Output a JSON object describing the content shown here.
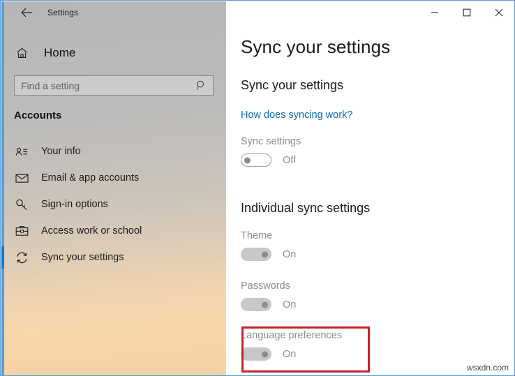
{
  "window": {
    "app_title": "Settings",
    "back_icon": "back-arrow-icon",
    "controls": {
      "minimize": "minimize-icon",
      "maximize": "maximize-icon",
      "close": "close-icon"
    },
    "accent_color": "#5a9bd5"
  },
  "sidebar": {
    "home_label": "Home",
    "home_icon": "home-icon",
    "search": {
      "placeholder": "Find a setting",
      "value": "",
      "icon": "search-icon"
    },
    "section_label": "Accounts",
    "items": [
      {
        "label": "Your info",
        "icon": "person-card-icon",
        "selected": false
      },
      {
        "label": "Email & app accounts",
        "icon": "envelope-icon",
        "selected": false
      },
      {
        "label": "Sign-in options",
        "icon": "key-icon",
        "selected": false
      },
      {
        "label": "Access work or school",
        "icon": "briefcase-icon",
        "selected": false
      },
      {
        "label": "Sync your settings",
        "icon": "sync-refresh-icon",
        "selected": true
      }
    ],
    "selected_accent": "#0a78d4"
  },
  "main": {
    "page_title": "Sync your settings",
    "subheading_1": "Sync your settings",
    "link_text": "How does syncing work?",
    "link_color": "#0a6cbe",
    "sync_settings": {
      "label": "Sync settings",
      "state": "Off",
      "toggle": "off"
    },
    "subheading_2": "Individual sync settings",
    "individual": [
      {
        "label": "Theme",
        "state": "On",
        "toggle": "on-disabled"
      },
      {
        "label": "Passwords",
        "state": "On",
        "toggle": "on-disabled"
      },
      {
        "label": "Language preferences",
        "state": "On",
        "toggle": "on-disabled"
      }
    ]
  },
  "annotation": {
    "highlight_color": "#c9202a",
    "target": "Language preferences"
  },
  "watermark": "wsxdn.com"
}
